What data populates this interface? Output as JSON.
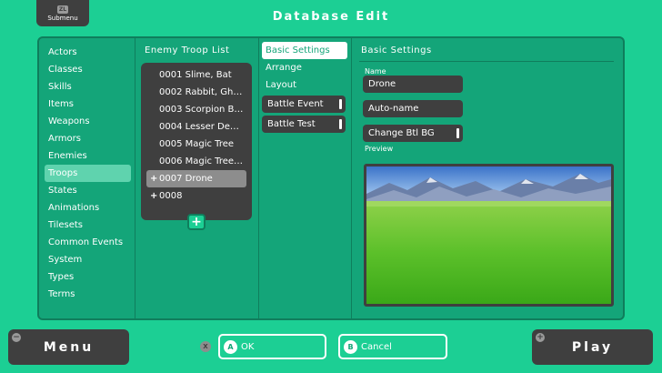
{
  "header": {
    "submenu_key": "ZL",
    "submenu_label": "Submenu",
    "title": "Database Edit"
  },
  "categories": [
    {
      "label": "Actors",
      "selected": false
    },
    {
      "label": "Classes",
      "selected": false
    },
    {
      "label": "Skills",
      "selected": false
    },
    {
      "label": "Items",
      "selected": false
    },
    {
      "label": "Weapons",
      "selected": false
    },
    {
      "label": "Armors",
      "selected": false
    },
    {
      "label": "Enemies",
      "selected": false
    },
    {
      "label": "Troops",
      "selected": true
    },
    {
      "label": "States",
      "selected": false
    },
    {
      "label": "Animations",
      "selected": false
    },
    {
      "label": "Tilesets",
      "selected": false
    },
    {
      "label": "Common Events",
      "selected": false
    },
    {
      "label": "System",
      "selected": false
    },
    {
      "label": "Types",
      "selected": false
    },
    {
      "label": "Terms",
      "selected": false
    }
  ],
  "troop_list": {
    "header": "Enemy Troop List",
    "items": [
      {
        "label": "0001 Slime, Bat",
        "plus": false,
        "selected": false
      },
      {
        "label": "0002 Rabbit, Gh…",
        "plus": false,
        "selected": false
      },
      {
        "label": "0003 Scorpion B…",
        "plus": false,
        "selected": false
      },
      {
        "label": "0004 Lesser De…",
        "plus": false,
        "selected": false
      },
      {
        "label": "0005 Magic Tree",
        "plus": false,
        "selected": false
      },
      {
        "label": "0006 Magic Tree…",
        "plus": false,
        "selected": false
      },
      {
        "label": "0007 Drone",
        "plus": true,
        "selected": true
      },
      {
        "label": "0008",
        "plus": true,
        "selected": false
      }
    ],
    "add_label": "+",
    "plus_symbol": "+"
  },
  "tabs": {
    "basic_settings": "Basic Settings",
    "arrange": "Arrange",
    "layout": "Layout",
    "battle_event": "Battle Event",
    "battle_test": "Battle Test"
  },
  "settings": {
    "title": "Basic Settings",
    "name_label": "Name",
    "name_value": "Drone",
    "auto_name": "Auto-name",
    "change_bg": "Change Btl BG",
    "preview_label": "Preview"
  },
  "footer": {
    "menu_label": "Menu",
    "play_label": "Play",
    "x_key": "X",
    "ok_key": "A",
    "ok_label": "OK",
    "cancel_key": "B",
    "cancel_label": "Cancel",
    "minus_symbol": "−",
    "plus_symbol": "+"
  },
  "colors": {
    "background": "#1ccf94",
    "panel": "#14a579",
    "dark": "#3f3f3f",
    "selected": "#5fd3ae"
  }
}
